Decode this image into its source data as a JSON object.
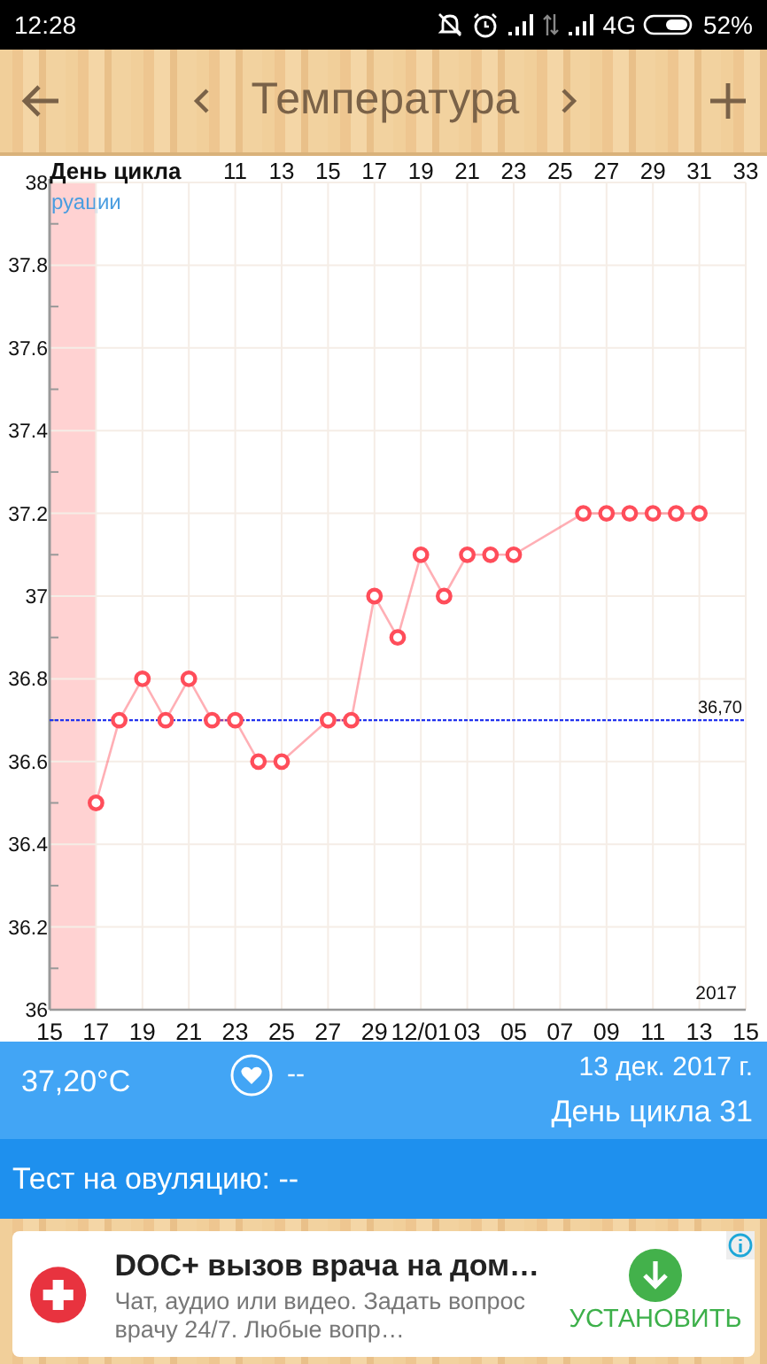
{
  "status_bar": {
    "time": "12:28",
    "network": "4G",
    "battery": "52%"
  },
  "header": {
    "title": "Температура"
  },
  "chart": {
    "cycle_axis": {
      "title": "День цикла",
      "labels": [
        "11",
        "13",
        "15",
        "17",
        "19",
        "21",
        "23",
        "25",
        "27",
        "29",
        "31",
        "33"
      ]
    },
    "band_label": "руации",
    "baseline_label": "36,70",
    "year_label": "2017",
    "chart_data": {
      "type": "line",
      "ylim": [
        36,
        38
      ],
      "categories": [
        "15",
        null,
        "17",
        null,
        "19",
        null,
        "21",
        null,
        "23",
        null,
        "25",
        null,
        "27",
        null,
        "29",
        null,
        "12/01",
        null,
        "03",
        null,
        "05",
        null,
        "07",
        null,
        "09",
        null,
        "11",
        null,
        "13",
        null,
        "15"
      ],
      "grid": true,
      "series": [
        {
          "color": "#ff4d5a",
          "marker": "circle",
          "values": [
            null,
            null,
            36.5,
            36.7,
            36.8,
            36.7,
            36.8,
            36.7,
            36.7,
            36.6,
            36.6,
            null,
            36.7,
            36.7,
            37.0,
            36.9,
            37.1,
            37.0,
            37.1,
            37.1,
            37.1,
            null,
            null,
            37.2,
            37.2,
            37.2,
            37.2,
            37.2,
            37.2,
            null,
            null
          ]
        }
      ],
      "yticks": [
        36,
        36.2,
        36.4,
        36.6,
        36.8,
        37,
        37.2,
        37.4,
        37.6,
        37.8,
        38
      ],
      "ref_lines": [
        {
          "axis": "y",
          "value": 36.7
        }
      ],
      "bands": [
        {
          "axis": "x",
          "from": "15",
          "to": "17"
        }
      ]
    }
  },
  "info": {
    "temperature": "37,20°C",
    "mark": "--",
    "date": "13 дек. 2017 г.",
    "cycle_day": "День цикла 31"
  },
  "ovulation_test": {
    "text": "Тест на овуляцию: --"
  },
  "ad": {
    "title": "DOC+ вызов врача на дом…",
    "text": "Чат, аудио или видео. Задать вопрос врачу 24/7. Любые вопр…",
    "button": "УСТАНОВИТЬ"
  }
}
